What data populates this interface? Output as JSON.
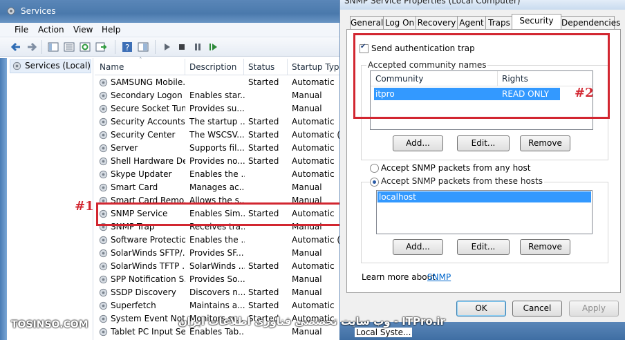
{
  "services_window": {
    "title": "Services",
    "menu": [
      "File",
      "Action",
      "View",
      "Help"
    ],
    "tree_item": "Services (Local)",
    "columns": [
      "Name",
      "Description",
      "Status",
      "Startup Type"
    ],
    "rows": [
      {
        "name": "SAMSUNG Mobile...",
        "desc": "",
        "status": "Started",
        "startup": "Automatic"
      },
      {
        "name": "Secondary Logon",
        "desc": "Enables star...",
        "status": "",
        "startup": "Manual"
      },
      {
        "name": "Secure Socket Tun...",
        "desc": "Provides su...",
        "status": "",
        "startup": "Manual"
      },
      {
        "name": "Security Accounts...",
        "desc": "The startup ...",
        "status": "Started",
        "startup": "Automatic"
      },
      {
        "name": "Security Center",
        "desc": "The WSCSV...",
        "status": "Started",
        "startup": "Automatic (D"
      },
      {
        "name": "Server",
        "desc": "Supports fil...",
        "status": "Started",
        "startup": "Automatic"
      },
      {
        "name": "Shell Hardware De...",
        "desc": "Provides no...",
        "status": "Started",
        "startup": "Automatic"
      },
      {
        "name": "Skype Updater",
        "desc": "Enables the ...",
        "status": "",
        "startup": "Automatic"
      },
      {
        "name": "Smart Card",
        "desc": "Manages ac...",
        "status": "",
        "startup": "Manual"
      },
      {
        "name": "Smart Card Remo...",
        "desc": "Allows the s...",
        "status": "",
        "startup": "Manual"
      },
      {
        "name": "SNMP Service",
        "desc": "Enables Sim...",
        "status": "Started",
        "startup": "Automatic"
      },
      {
        "name": "SNMP Trap",
        "desc": "Receives tra...",
        "status": "",
        "startup": "Manual"
      },
      {
        "name": "Software Protection",
        "desc": "Enables the ...",
        "status": "",
        "startup": "Automatic (D"
      },
      {
        "name": "SolarWinds SFTP/...",
        "desc": "Provides SF...",
        "status": "",
        "startup": "Manual"
      },
      {
        "name": "SolarWinds TFTP ...",
        "desc": "SolarWinds ...",
        "status": "Started",
        "startup": "Automatic"
      },
      {
        "name": "SPP Notification S...",
        "desc": "Provides So...",
        "status": "",
        "startup": "Manual"
      },
      {
        "name": "SSDP Discovery",
        "desc": "Discovers n...",
        "status": "Started",
        "startup": "Manual"
      },
      {
        "name": "Superfetch",
        "desc": "Maintains a...",
        "status": "Started",
        "startup": "Automatic"
      },
      {
        "name": "System Event Noti...",
        "desc": "Monitors sy...",
        "status": "Started",
        "startup": "Automatic"
      },
      {
        "name": "Tablet PC Input Se...",
        "desc": "Enables Tab...",
        "status": "",
        "startup": "Manual"
      }
    ]
  },
  "dialog": {
    "title": "SNMP Service Properties (Local Computer)",
    "tabs": [
      "General",
      "Log On",
      "Recovery",
      "Agent",
      "Traps",
      "Security",
      "Dependencies"
    ],
    "send_auth_trap": "Send authentication trap",
    "community_group": "Accepted community names",
    "community_header": "Community",
    "rights_header": "Rights",
    "community_row": {
      "community": "itpro",
      "rights": "READ ONLY"
    },
    "buttons": {
      "add": "Add...",
      "edit": "Edit...",
      "remove": "Remove"
    },
    "accept_any": "Accept SNMP packets from any host",
    "accept_these": "Accept SNMP packets from these hosts",
    "hosts": [
      "localhost"
    ],
    "learn_more": "Learn more about",
    "learn_link": "SNMP",
    "ok": "OK",
    "cancel": "Cancel",
    "apply": "Apply"
  },
  "annotations": {
    "label1": "#1",
    "label2": "#2"
  },
  "watermarks": {
    "left": "TOSINSO.COM",
    "center": "وب سایت تخصصی فناوری اطلاعات ایران - ITPro.ir"
  },
  "taskbar": {
    "text": "Local Syste..."
  },
  "colors": {
    "highlight": "#d22630",
    "selection": "#3399ff"
  }
}
